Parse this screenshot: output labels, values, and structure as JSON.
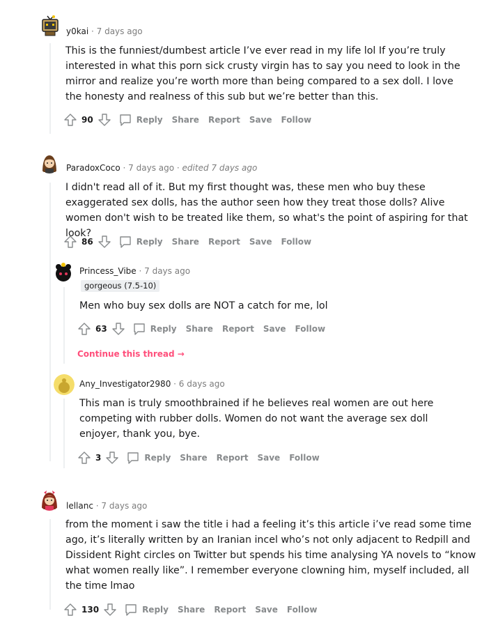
{
  "actions": {
    "reply": "Reply",
    "share": "Share",
    "report": "Report",
    "save": "Save",
    "follow": "Follow"
  },
  "comments": [
    {
      "user": "y0kai",
      "time": "7 days ago",
      "body": "This is the funniest/dumbest article I’ve ever read in my life lol If you’re truly interested in what this porn sick crusty virgin has to say you need to look in the mirror and realize you’re worth more than being compared to a sex doll. I love the honesty and realness of this sub but we’re better than this.",
      "score": "90"
    },
    {
      "user": "ParadoxCoco",
      "time": "7 days ago",
      "edited": "edited 7 days ago",
      "body": "I didn't read all of it. But my first thought was, these men who buy these exaggerated sex dolls, has the author seen how they treat those dolls? Alive women don't wish to be treated like them, so what's the point of aspiring for that look?",
      "score": "86"
    },
    {
      "user": "Princess_Vibe",
      "time": "7 days ago",
      "flair": "gorgeous (7.5-10)",
      "body": "Men who buy sex dolls are NOT a catch for me, lol",
      "score": "63",
      "continue": "Continue this thread →"
    },
    {
      "user": "Any_Investigator2980",
      "time": "6 days ago",
      "body": "This man is truly smoothbrained if he believes real women are out here competing with rubber dolls. Women do not want the average sex doll enjoyer, thank you, bye.",
      "score": "3"
    },
    {
      "user": "lellanc",
      "time": "7 days ago",
      "body": "from the moment i saw the title i had a feeling it’s this article i’ve read some time ago, it’s literally written by an Iranian incel who’s not only adjacent to Redpill and Dissident Right circles on Twitter but spends his time analysing YA novels to “know what women really like”. I remember everyone clowning him, myself included, all the time lmao",
      "score": "130"
    }
  ]
}
